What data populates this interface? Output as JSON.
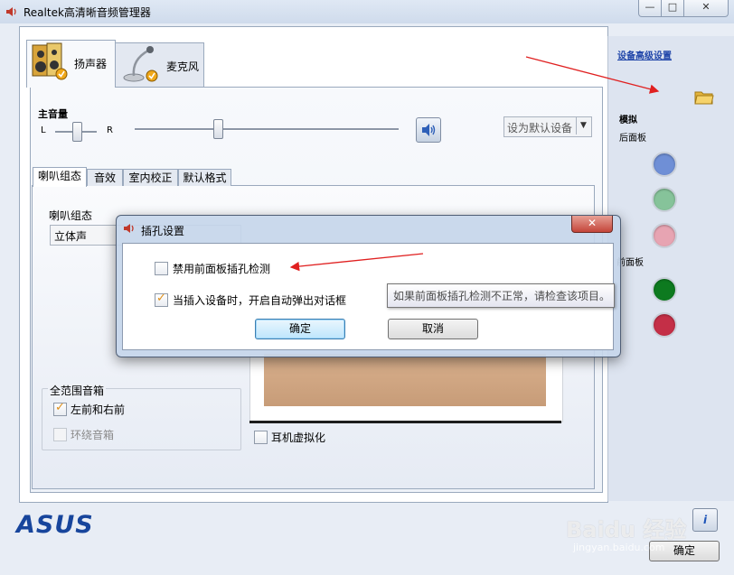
{
  "window": {
    "title": "Realtek高清晰音频管理器",
    "controls": {
      "minimize": "—",
      "maximize": "□",
      "close": "✕"
    }
  },
  "device_tabs": [
    {
      "label": "扬声器",
      "icon": "speaker-icon",
      "selected": true
    },
    {
      "label": "麦克风",
      "icon": "microphone-icon",
      "selected": false
    }
  ],
  "volume": {
    "title": "主音量",
    "left": "L",
    "right": "R",
    "mute_icon": "speaker-volume-icon"
  },
  "default_device": {
    "label": "设为默认设备"
  },
  "sub_tabs": [
    "喇叭组态",
    "音效",
    "室内校正",
    "默认格式"
  ],
  "speaker_config": {
    "label": "喇叭组态",
    "selected": "立体声"
  },
  "full_range": {
    "title": "全范围音箱",
    "front": {
      "label": "左前和右前",
      "checked": true
    },
    "surround": {
      "label": "环绕音箱",
      "checked": false,
      "disabled": true
    }
  },
  "headphone_virtualization": {
    "label": "耳机虚拟化",
    "checked": false
  },
  "right_panel": {
    "link": "设备高级设置",
    "folder_icon": "folder-icon",
    "analog": "模拟",
    "rear_panel": "后面板",
    "front_panel": "前面板",
    "rear_jacks": [
      "#6f8fd6",
      "#86c39a",
      "#e7a4b2"
    ],
    "front_jacks": [
      "#0d7a1f",
      "#c42f47"
    ]
  },
  "footer": {
    "logo": "ASUS",
    "info_icon": "i",
    "ok_label": "确定"
  },
  "dialog": {
    "title": "插孔设置",
    "close": "✕",
    "option1": {
      "label": "禁用前面板插孔检测",
      "checked": false
    },
    "option2": {
      "label": "当插入设备时，开启自动弹出对话框",
      "checked": true
    },
    "ok_label": "确定",
    "cancel_label": "取消"
  },
  "tooltip": {
    "text": "如果前面板插孔检测不正常，请检查该项目。"
  },
  "watermark": {
    "text": "Baidu 经验",
    "sub": "jingyan.baidu.com"
  },
  "colors": {
    "accent": "#17459c",
    "link": "#1d43a8",
    "arrow": "#e02020"
  }
}
